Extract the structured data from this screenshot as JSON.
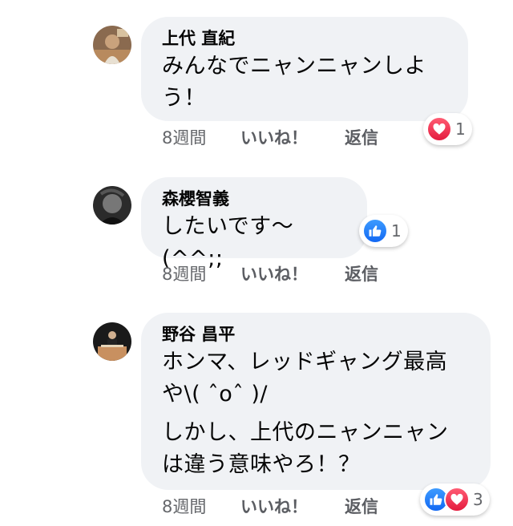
{
  "comments": [
    {
      "author": "上代 直紀",
      "text": "みんなでニャンニャンしよ\nう！",
      "time": "8週間",
      "like_label": "いいね！",
      "reply_label": "返信",
      "reaction_count": "1",
      "reactions": [
        "love"
      ]
    },
    {
      "author": "森櫻智義",
      "text": "したいです〜(^^;;",
      "time": "8週間",
      "like_label": "いいね！",
      "reply_label": "返信",
      "reaction_count": "1",
      "reactions": [
        "like"
      ]
    },
    {
      "author": "野谷 昌平",
      "text": "ホンマ、レッドギャング最高\nや\\( ˆoˆ )/",
      "text2": "しかし、上代のニャンニャン\nは違う意味やろ！？",
      "time": "8週間",
      "like_label": "いいね！",
      "reply_label": "返信",
      "reaction_count": "3",
      "reactions": [
        "like",
        "love"
      ]
    }
  ],
  "colors": {
    "bubble": "#f0f2f5",
    "meta": "#65676b",
    "like": "#1877f2",
    "love": "#f33e58"
  }
}
